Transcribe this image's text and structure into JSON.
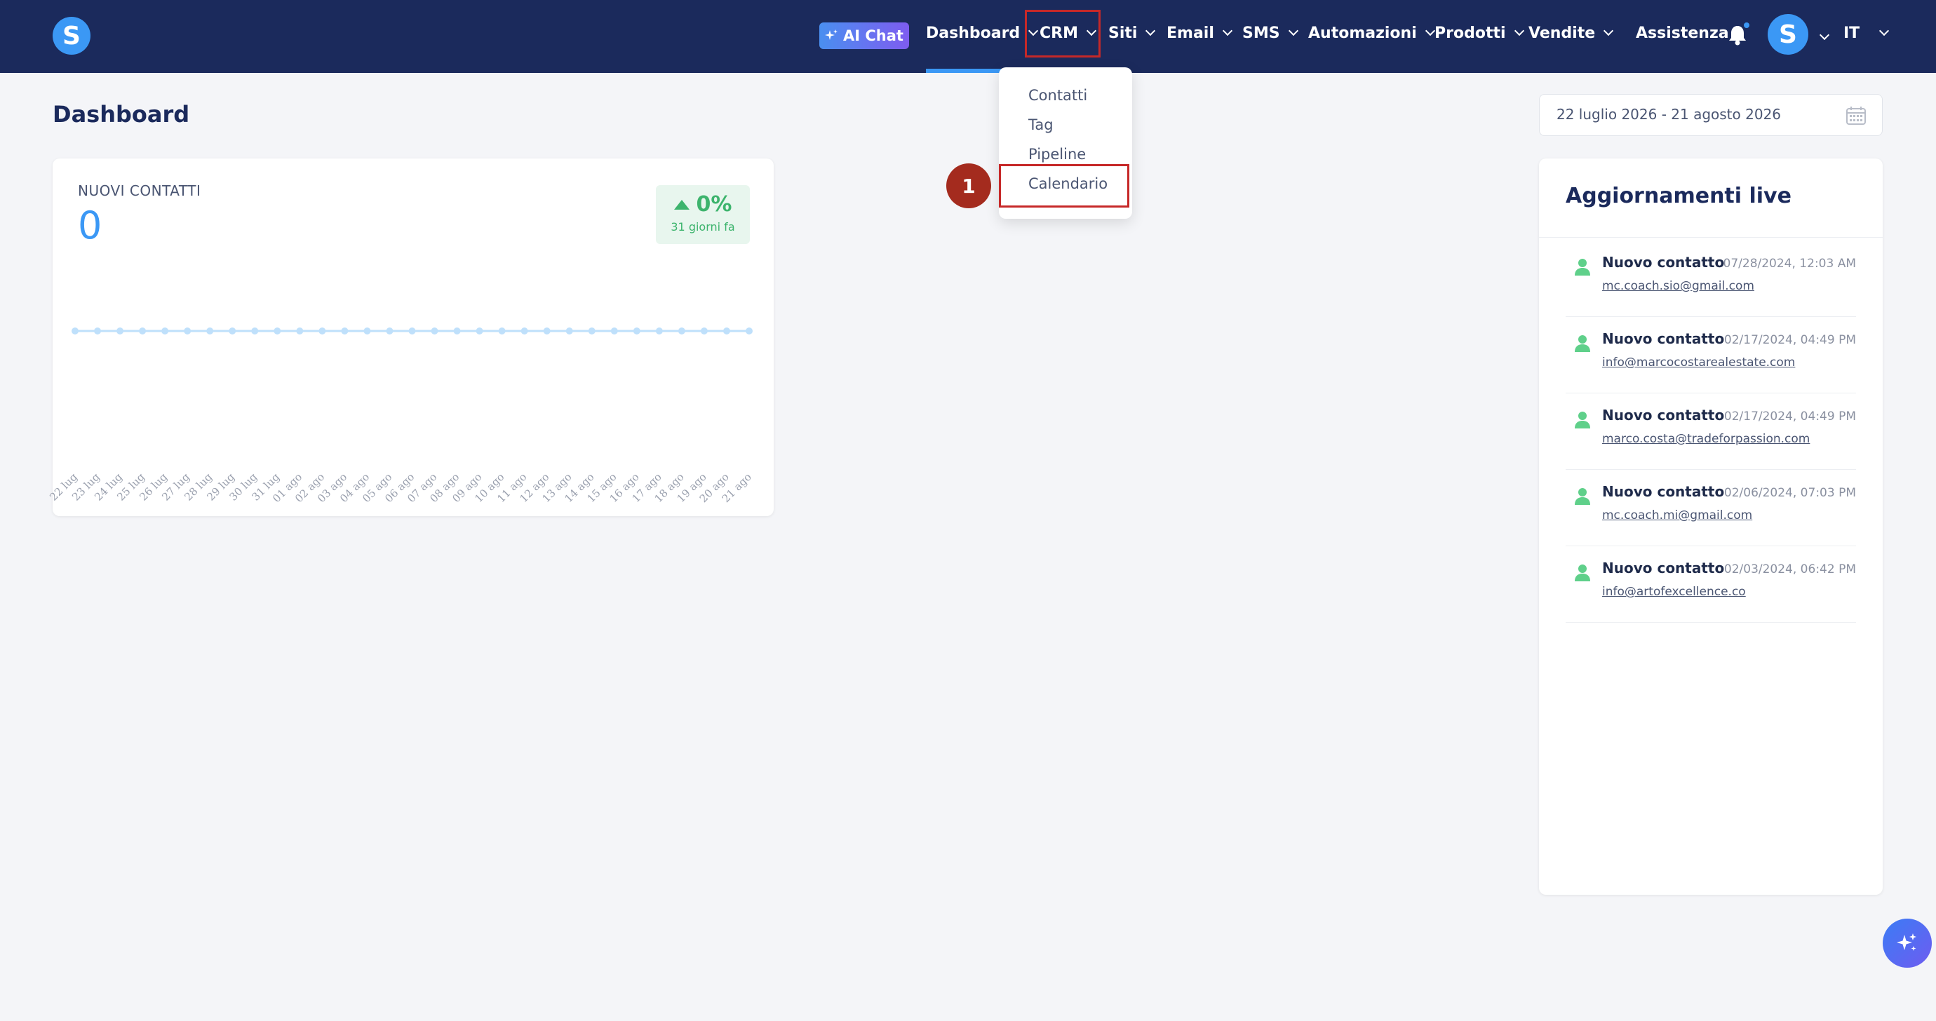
{
  "nav": {
    "logo": "S",
    "ai_chat": "AI Chat",
    "items": [
      "Dashboard",
      "CRM",
      "Siti",
      "Email",
      "SMS",
      "Automazioni",
      "Prodotti",
      "Vendite"
    ],
    "support": "Assistenza",
    "avatar": "S",
    "lang": "IT"
  },
  "dropdown": {
    "items": [
      "Contatti",
      "Tag",
      "Pipeline",
      "Calendario"
    ],
    "step": "1"
  },
  "page": {
    "title": "Dashboard"
  },
  "date_range": "22 luglio 2026 - 21 agosto 2026",
  "card": {
    "label": "NUOVI CONTATTI",
    "value": "0",
    "delta_pct": "0%",
    "delta_sub": "31 giorni fa"
  },
  "chart_data": {
    "type": "line",
    "categories": [
      "22 lug",
      "23 lug",
      "24 lug",
      "25 lug",
      "26 lug",
      "27 lug",
      "28 lug",
      "29 lug",
      "30 lug",
      "31 lug",
      "01 ago",
      "02 ago",
      "03 ago",
      "04 ago",
      "05 ago",
      "06 ago",
      "07 ago",
      "08 ago",
      "09 ago",
      "10 ago",
      "11 ago",
      "12 ago",
      "13 ago",
      "14 ago",
      "15 ago",
      "16 ago",
      "17 ago",
      "18 ago",
      "19 ago",
      "20 ago",
      "21 ago"
    ],
    "values": [
      0,
      0,
      0,
      0,
      0,
      0,
      0,
      0,
      0,
      0,
      0,
      0,
      0,
      0,
      0,
      0,
      0,
      0,
      0,
      0,
      0,
      0,
      0,
      0,
      0,
      0,
      0,
      0,
      0,
      0,
      0
    ],
    "title": "",
    "xlabel": "",
    "ylabel": "",
    "color": "#bfe0fb"
  },
  "live": {
    "title": "Aggiornamenti live",
    "items": [
      {
        "title": "Nuovo contatto",
        "time": "07/28/2024, 12:03 AM",
        "email": "mc.coach.sio@gmail.com"
      },
      {
        "title": "Nuovo contatto",
        "time": "02/17/2024, 04:49 PM",
        "email": "info@marcocostarealestate.com"
      },
      {
        "title": "Nuovo contatto",
        "time": "02/17/2024, 04:49 PM",
        "email": "marco.costa@tradeforpassion.com"
      },
      {
        "title": "Nuovo contatto",
        "time": "02/06/2024, 07:03 PM",
        "email": "mc.coach.mi@gmail.com"
      },
      {
        "title": "Nuovo contatto",
        "time": "02/03/2024, 06:42 PM",
        "email": "info@artofexcellence.co"
      }
    ]
  }
}
